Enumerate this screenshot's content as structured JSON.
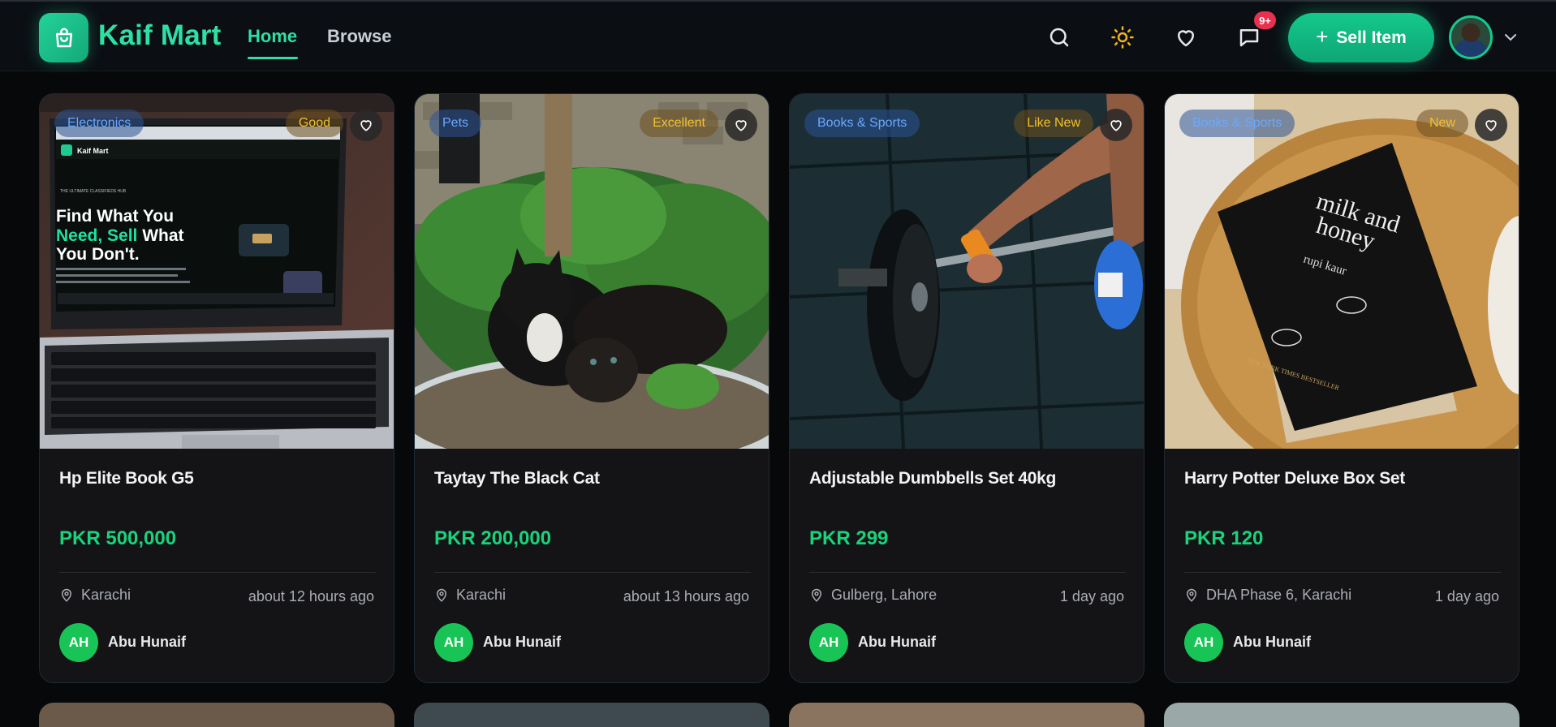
{
  "header": {
    "logo_text": "Kaif Mart",
    "nav": [
      {
        "label": "Home",
        "active": true
      },
      {
        "label": "Browse",
        "active": false
      }
    ],
    "icons": [
      "search-icon",
      "sun-icon",
      "heart-icon",
      "chat-icon"
    ],
    "messages_badge": "9+",
    "sell_button": "Sell Item",
    "accent_color": "#2ee0a3"
  },
  "listings": [
    {
      "category": "Electronics",
      "condition": "Good",
      "title": "Hp Elite Book G5",
      "price": "PKR 500,000",
      "location": "Karachi",
      "time": "about 12 hours ago",
      "seller_initials": "AH",
      "seller_name": "Abu Hunaif",
      "image": "laptop-photo",
      "screen_text": {
        "brand": "Kaif Mart",
        "tag": "THE ULTIMATE CLASSIFIEDS HUB",
        "headline_1": "Find What You",
        "headline_2a": "Need, Sell",
        "headline_2b": " What",
        "headline_3": "You Don't."
      }
    },
    {
      "category": "Pets",
      "condition": "Excellent",
      "title": "Taytay The Black Cat",
      "price": "PKR 200,000",
      "location": "Karachi",
      "time": "about 13 hours ago",
      "seller_initials": "AH",
      "seller_name": "Abu Hunaif",
      "image": "cats-photo"
    },
    {
      "category": "Books & Sports",
      "condition": "Like New",
      "title": "Adjustable Dumbbells Set 40kg",
      "price": "PKR 299",
      "location": "Gulberg, Lahore",
      "time": "1 day ago",
      "seller_initials": "AH",
      "seller_name": "Abu Hunaif",
      "image": "barbell-photo"
    },
    {
      "category": "Books & Sports",
      "condition": "New",
      "title": "Harry Potter Deluxe Box Set",
      "price": "PKR 120",
      "location": "DHA Phase 6, Karachi",
      "time": "1 day ago",
      "seller_initials": "AH",
      "seller_name": "Abu Hunaif",
      "image": "book-photo",
      "book_text": {
        "title_line1": "milk and",
        "title_line2": "honey",
        "author": "rupi kaur",
        "bestseller": "NEW YORK TIMES BESTSELLER"
      }
    }
  ]
}
